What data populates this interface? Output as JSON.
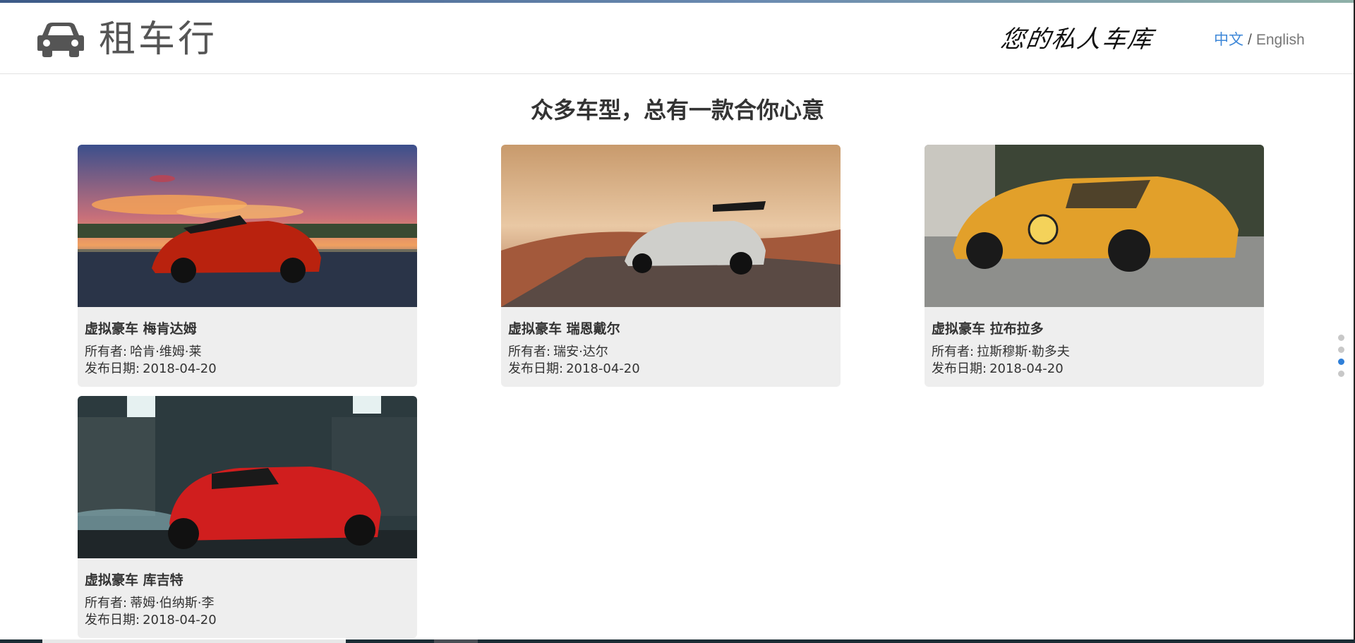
{
  "header": {
    "brand_icon": "car-icon",
    "brand_name": "租车行",
    "slogan": "您的私人车库",
    "lang": {
      "zh": "中文",
      "separator": "/",
      "en": "English"
    }
  },
  "main": {
    "title": "众多车型，总有一款合你心意",
    "cards": [
      {
        "name": "虚拟豪车 梅肯达姆",
        "owner_label": "所有者:",
        "owner": "哈肯·维姆·莱",
        "date_label": "发布日期:",
        "date": "2018-04-20"
      },
      {
        "name": "虚拟豪车 瑞恩戴尔",
        "owner_label": "所有者:",
        "owner": "瑞安·达尔",
        "date_label": "发布日期:",
        "date": "2018-04-20"
      },
      {
        "name": "虚拟豪车 拉布拉多",
        "owner_label": "所有者:",
        "owner": "拉斯穆斯·勒多夫",
        "date_label": "发布日期:",
        "date": "2018-04-20"
      },
      {
        "name": "虚拟豪车 库吉特",
        "owner_label": "所有者:",
        "owner": "蒂姆·伯纳斯·李",
        "date_label": "发布日期:",
        "date": "2018-04-20"
      }
    ]
  },
  "pager": {
    "dot_count": 4,
    "active_index": 2
  },
  "colors": {
    "accent": "#3d87d8",
    "card_bg": "#eeeeee",
    "active_dot": "#2f7fd8"
  }
}
